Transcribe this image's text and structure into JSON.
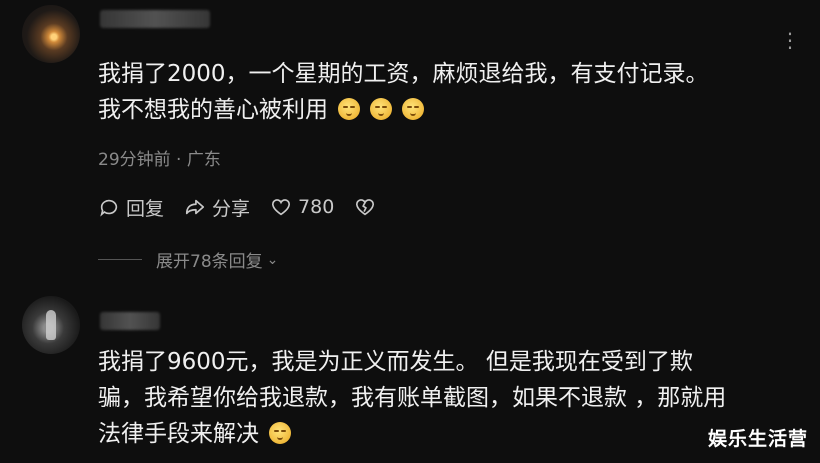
{
  "comments": [
    {
      "text_lines": [
        "我捐了2000，一个星期的工资，麻烦退给我，有支付记录。",
        "我不想我的善心被利用"
      ],
      "emoji_count": 3,
      "time_location": "29分钟前 · 广东",
      "actions": {
        "reply": "回复",
        "share": "分享",
        "like_count": "780"
      },
      "expand": "展开78条回复"
    },
    {
      "text_lines": [
        "我捐了9600元，我是为正义而发生。 但是我现在受到了欺",
        "骗，我希望你给我退款，我有账单截图，如果不退款 ，那就用",
        "法律手段来解决"
      ],
      "emoji_count": 1
    }
  ],
  "watermark": "娱乐生活营",
  "icons": {
    "reply": "comment-bubble-icon",
    "share": "share-arrow-icon",
    "like": "heart-icon",
    "dislike": "broken-heart-icon",
    "more": "more-dots-icon",
    "emoji": "smiling-face-emoji"
  }
}
